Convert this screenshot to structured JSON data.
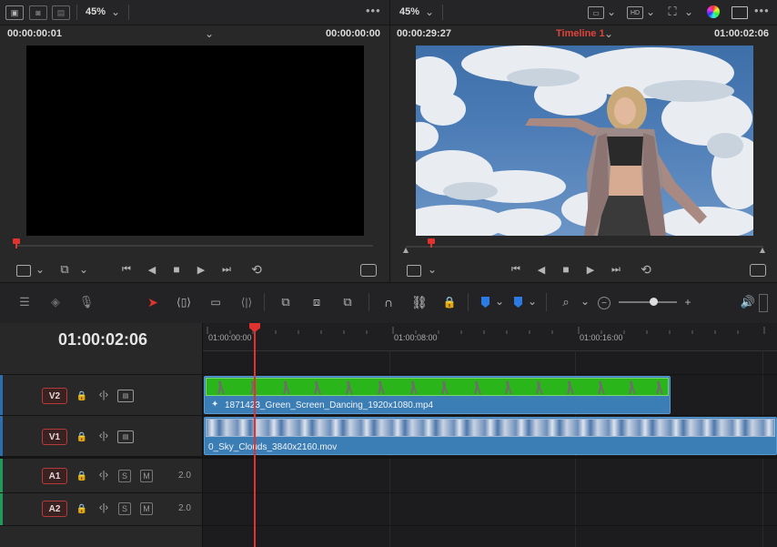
{
  "viewer_left": {
    "zoom": "45%",
    "timecode_left": "00:00:00:01",
    "timecode_right": "00:00:00:00"
  },
  "viewer_right": {
    "zoom": "45%",
    "timecode_left": "00:00:29:27",
    "timeline_name": "Timeline 1",
    "timecode_right": "01:00:02:06"
  },
  "timeline": {
    "current_timecode": "01:00:02:06",
    "ruler_labels": [
      "01:00:00:00",
      "01:00:08:00",
      "01:00:16:00"
    ]
  },
  "tracks": [
    {
      "label": "V2"
    },
    {
      "label": "V1"
    },
    {
      "label": "A1",
      "level": "2.0",
      "solo": "S",
      "mute": "M"
    },
    {
      "label": "A2",
      "level": "2.0",
      "solo": "S",
      "mute": "M"
    }
  ],
  "clips": {
    "v2": {
      "name": "1871423_Green_Screen_Dancing_1920x1080.mp4"
    },
    "v1": {
      "name": "0_Sky_Clouds_3840x2160.mov"
    }
  },
  "colors": {
    "playhead": "#e0322f",
    "clip_blue": "#3b7db5",
    "green_screen": "#2ab51a",
    "timeline_name": "#e0433a"
  }
}
